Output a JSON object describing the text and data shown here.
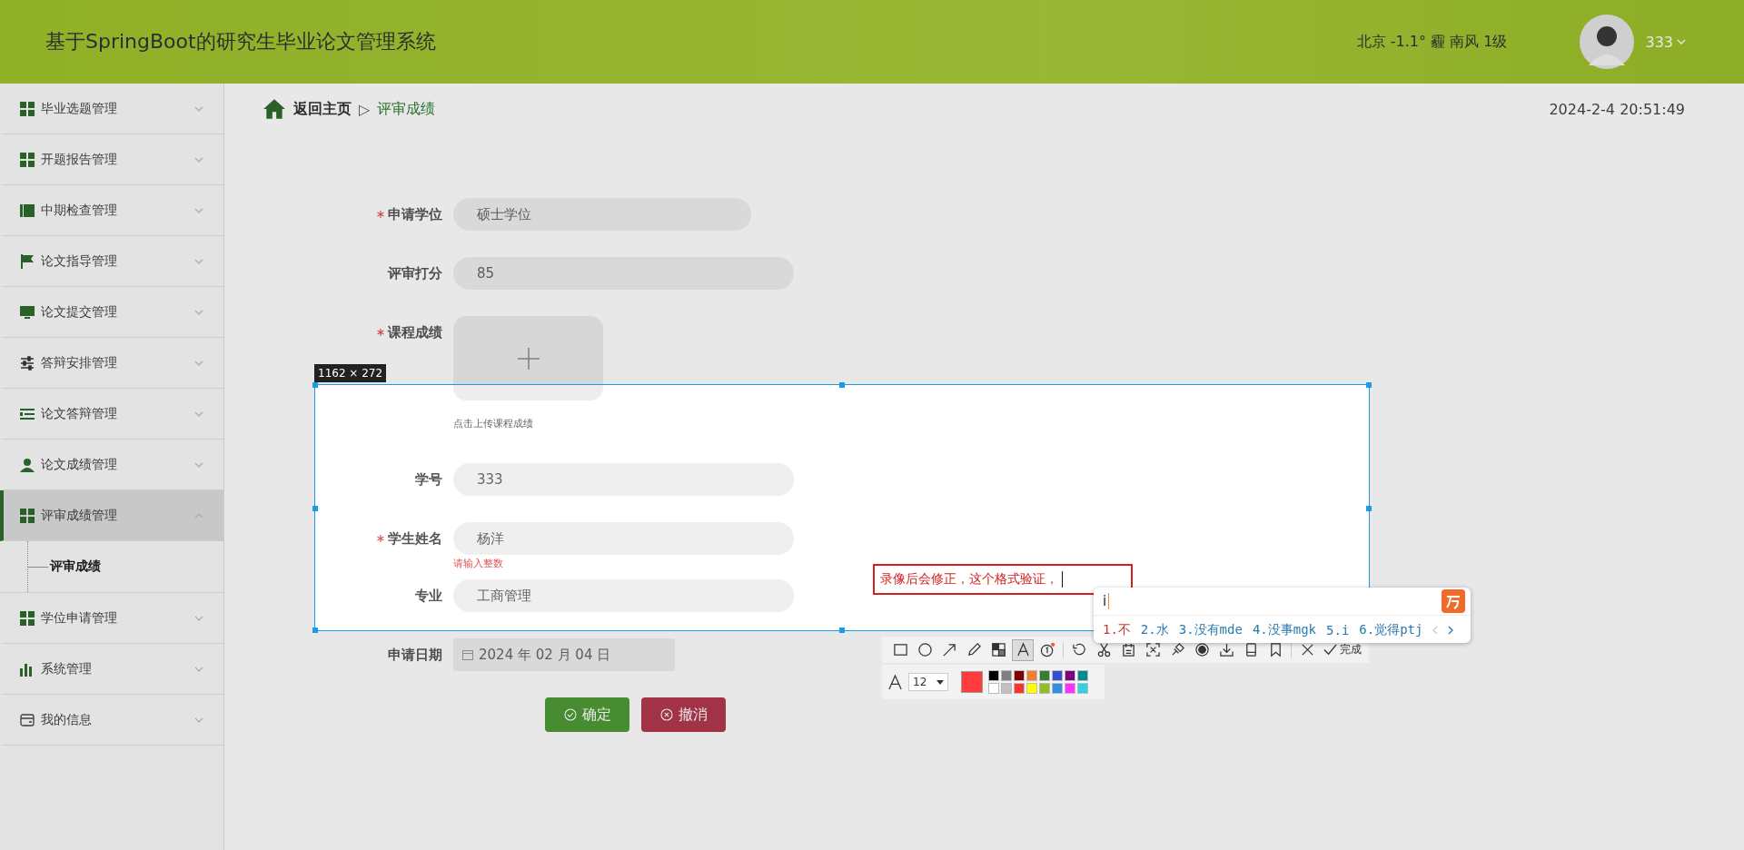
{
  "header": {
    "title": "基于SpringBoot的研究生毕业论文管理系统",
    "weather": "北京 -1.1° 霾 南风 1级",
    "user": "333"
  },
  "sidebar": {
    "items": [
      {
        "label": "毕业选题管理",
        "selected": false,
        "expanded": false
      },
      {
        "label": "开题报告管理",
        "selected": false,
        "expanded": false
      },
      {
        "label": "中期检查管理",
        "selected": false,
        "expanded": false
      },
      {
        "label": "论文指导管理",
        "selected": false,
        "expanded": false
      },
      {
        "label": "论文提交管理",
        "selected": false,
        "expanded": false
      },
      {
        "label": "答辩安排管理",
        "selected": false,
        "expanded": false
      },
      {
        "label": "论文答辩管理",
        "selected": false,
        "expanded": false
      },
      {
        "label": "论文成绩管理",
        "selected": false,
        "expanded": false
      },
      {
        "label": "评审成绩管理",
        "selected": true,
        "expanded": true,
        "children": [
          {
            "label": "评审成绩",
            "selected": true
          }
        ]
      },
      {
        "label": "学位申请管理",
        "selected": false,
        "expanded": false
      },
      {
        "label": "系统管理",
        "selected": false,
        "expanded": false
      },
      {
        "label": "我的信息",
        "selected": false,
        "expanded": false
      }
    ]
  },
  "breadcrumb": {
    "home": "返回主页",
    "separator": "▷",
    "current": "评审成绩"
  },
  "datetime": "2024-2-4 20:51:49",
  "form": {
    "fields": [
      {
        "kind": "input",
        "label": "申请学位",
        "required": true,
        "value": "硕士学位"
      },
      {
        "kind": "input",
        "label": "评审打分",
        "required": false,
        "value": "85"
      },
      {
        "kind": "upload",
        "label": "课程成绩",
        "required": true,
        "hint": "点击上传课程成绩"
      },
      {
        "kind": "input",
        "label": "学号",
        "required": false,
        "value": "333"
      },
      {
        "kind": "input",
        "label": "学生姓名",
        "required": true,
        "value": "杨洋",
        "error": "请输入整数"
      },
      {
        "kind": "input",
        "label": "专业",
        "required": false,
        "value": "工商管理"
      },
      {
        "kind": "date",
        "label": "申请日期",
        "required": false,
        "value": "2024 年 02 月 04 日"
      }
    ],
    "buttons": [
      {
        "label": "确定",
        "kind": "confirm"
      },
      {
        "label": "撤消",
        "kind": "cancel"
      }
    ]
  },
  "capture": {
    "size_label": "1162 × 272",
    "annotation": "录像后会修正，这个格式验证，",
    "ime": {
      "input": "i",
      "candidates": [
        {
          "text": "1.不",
          "selected": true
        },
        {
          "text": "2.水",
          "selected": false
        },
        {
          "text": "3.没有mde",
          "selected": false
        },
        {
          "text": "4.没事mgk",
          "selected": false
        },
        {
          "text": "5.i",
          "selected": false
        },
        {
          "text": "6.觉得ptj",
          "selected": false
        }
      ]
    },
    "toolbar": {
      "tools": [
        {
          "selected": false
        },
        {
          "selected": false
        },
        {
          "selected": false
        },
        {
          "selected": false
        },
        {
          "selected": false
        },
        {
          "selected": true
        },
        {
          "selected": false
        },
        {
          "selected": false
        },
        {
          "selected": false
        },
        {
          "selected": false
        },
        {
          "selected": false
        },
        {
          "selected": false
        },
        {
          "selected": false
        },
        {
          "selected": false
        },
        {
          "selected": false
        },
        {
          "selected": false
        },
        {
          "selected": false
        }
      ],
      "done": "完成"
    },
    "style_bar": {
      "font_size": "12",
      "color": "#ff3b3b",
      "palette": [
        {
          "color": "#000000"
        },
        {
          "color": "#808080"
        },
        {
          "color": "#800000"
        },
        {
          "color": "#f08030"
        },
        {
          "color": "#308030"
        },
        {
          "color": "#3050d0"
        },
        {
          "color": "#800080"
        },
        {
          "color": "#008b8b"
        },
        {
          "color": "#ffffff"
        },
        {
          "color": "#c0c0c0"
        },
        {
          "color": "#ff3030"
        },
        {
          "color": "#ffff00"
        },
        {
          "color": "#90c020"
        },
        {
          "color": "#3090e0"
        },
        {
          "color": "#ff30ff"
        },
        {
          "color": "#30d0e0"
        }
      ]
    }
  }
}
